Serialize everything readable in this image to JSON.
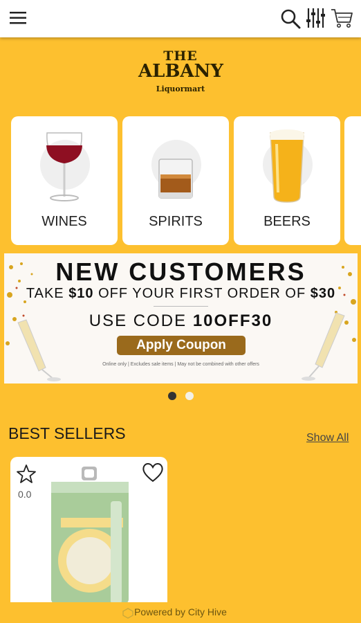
{
  "header": {
    "menu_icon": "hamburger-menu-icon",
    "search_icon": "search-icon",
    "filter_icon": "filter-sliders-icon",
    "cart_icon": "cart-icon"
  },
  "logo": {
    "line1": "THE",
    "line2": "ALBANY",
    "line3": "Liquormart"
  },
  "categories": [
    {
      "label": "WINES",
      "icon": "wine-glass-icon"
    },
    {
      "label": "SPIRITS",
      "icon": "whiskey-glass-icon"
    },
    {
      "label": "BEERS",
      "icon": "beer-glass-icon"
    }
  ],
  "banner": {
    "title": "NEW CUSTOMERS",
    "line2_prefix": "TAKE ",
    "line2_amount": "$10",
    "line2_middle": " OFF YOUR FIRST ORDER OF ",
    "line2_min": "$30",
    "code_prefix": "USE CODE ",
    "code": "10OFF30",
    "button": "Apply Coupon",
    "fine_print": "Online only | Excludes sale items | May not be combined with other offers"
  },
  "carousel": {
    "total_slides": 2,
    "active_slide": 1
  },
  "best_sellers": {
    "title": "BEST SELLERS",
    "show_all": "Show All",
    "products": [
      {
        "rating": "0.0",
        "image": "beer-can-icon",
        "favorite": false
      }
    ]
  },
  "footer": {
    "text": "Powered by City Hive"
  },
  "colors": {
    "background": "#FDC02F",
    "card": "#FFFFFF",
    "coupon_button": "#9A6A1C"
  }
}
